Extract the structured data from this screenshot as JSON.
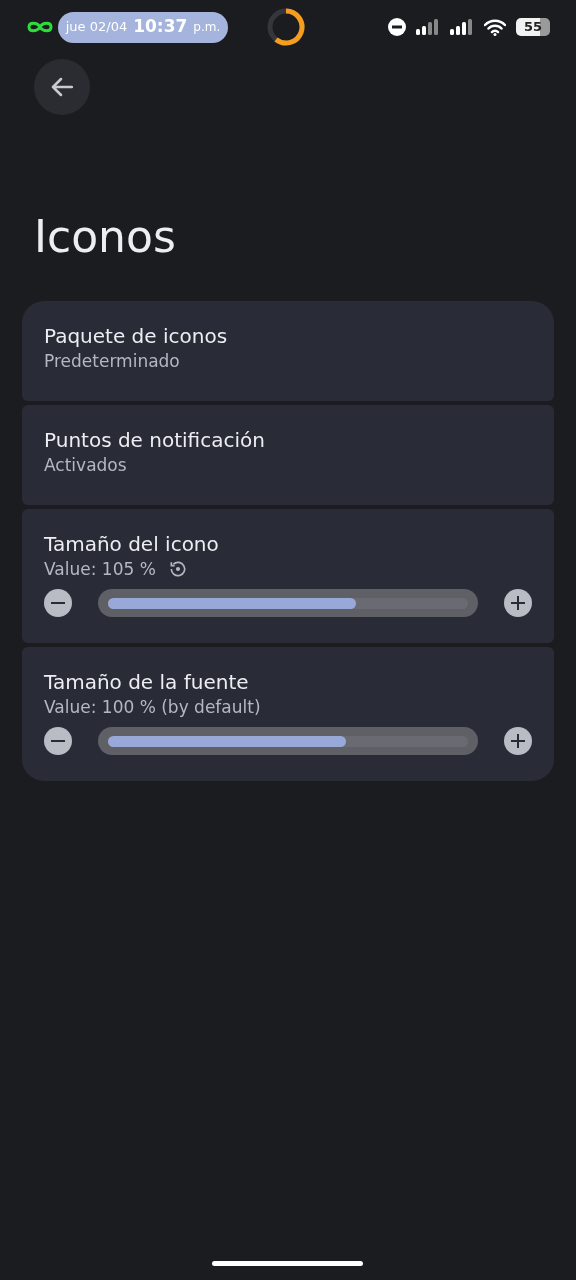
{
  "status_bar": {
    "date": "jue 02/04",
    "time": "10:37",
    "ampm": "p.m.",
    "battery": "55"
  },
  "title": "Iconos",
  "settings": [
    {
      "kind": "text",
      "title": "Paquete de iconos",
      "subtitle": "Predeterminado"
    },
    {
      "kind": "text",
      "title": "Puntos de notificación",
      "subtitle": "Activados"
    },
    {
      "kind": "slider",
      "title": "Tamaño del icono",
      "subtitle": "Value: 105 %",
      "reset": true,
      "level": 0.69
    },
    {
      "kind": "slider",
      "title": "Tamaño de la fuente",
      "subtitle": "Value: 100 % (by default)",
      "reset": false,
      "level": 0.66
    }
  ]
}
